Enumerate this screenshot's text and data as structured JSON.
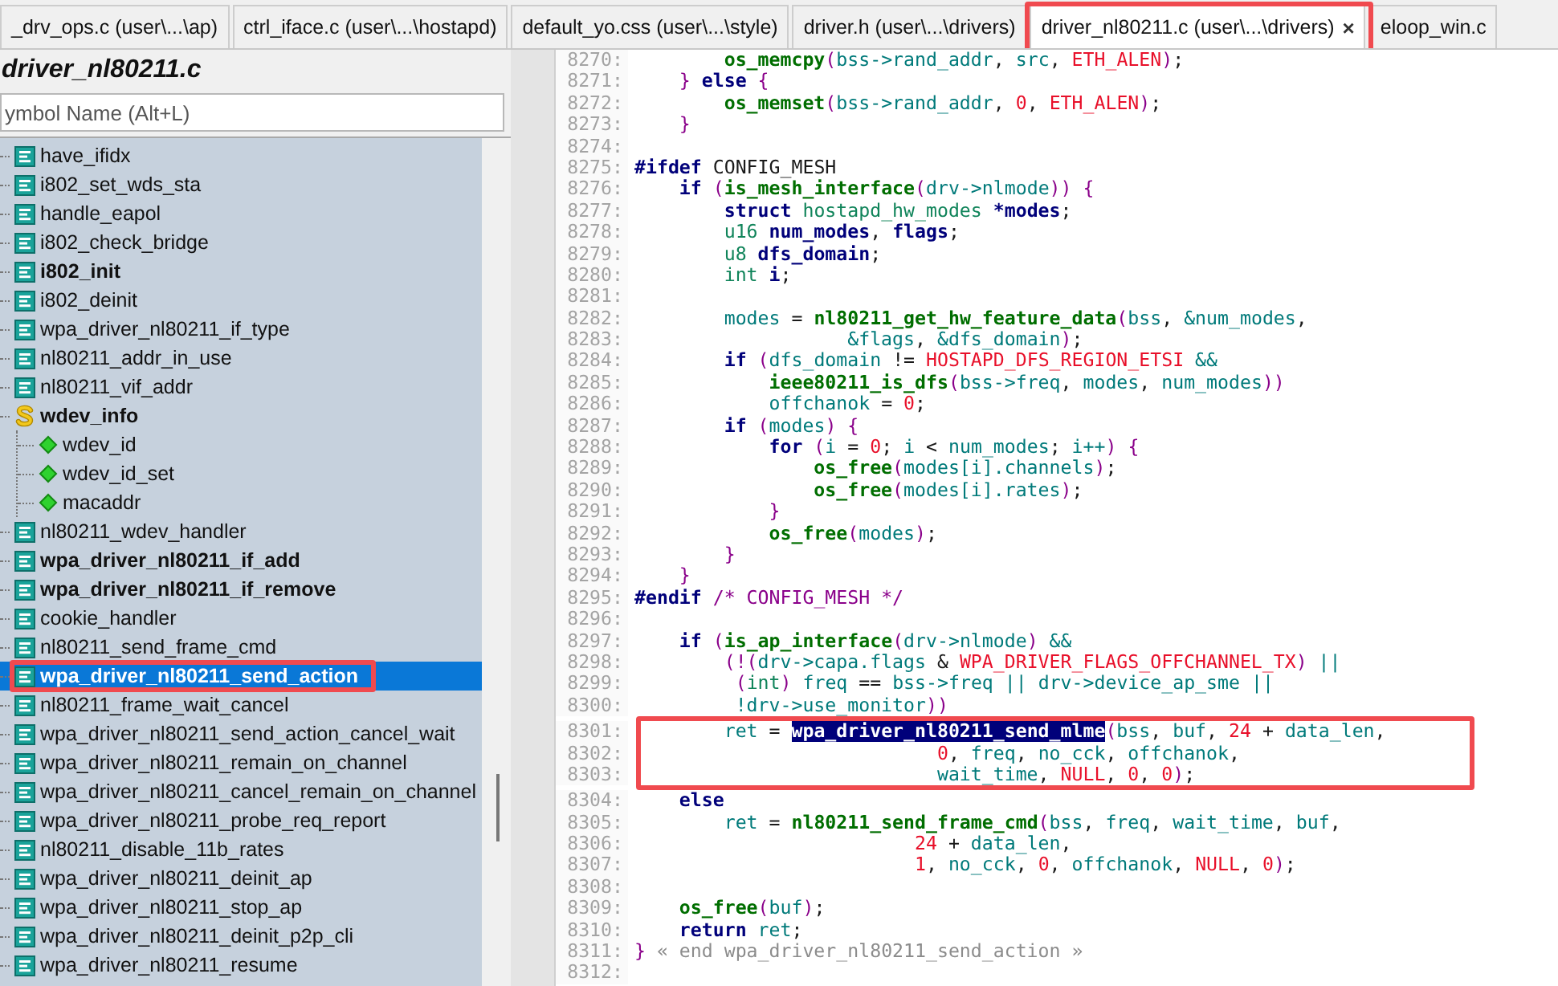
{
  "tabs": [
    {
      "label": "_drv_ops.c (user\\...\\ap)",
      "selected": false,
      "annotated": false
    },
    {
      "label": "ctrl_iface.c (user\\...\\hostapd)",
      "selected": false,
      "annotated": false
    },
    {
      "label": "default_yo.css (user\\...\\style)",
      "selected": false,
      "annotated": false
    },
    {
      "label": "driver.h (user\\...\\drivers)",
      "selected": false,
      "annotated": false
    },
    {
      "label": "driver_nl80211.c (user\\...\\drivers)",
      "selected": true,
      "annotated": true,
      "close": "×"
    },
    {
      "label": "eloop_win.c",
      "selected": false,
      "annotated": false
    }
  ],
  "symbol_panel": {
    "title": "driver_nl80211.c",
    "search": {
      "placeholder": "ymbol Name (Alt+L)"
    },
    "items": [
      {
        "label": "have_ifidx",
        "kind": "function",
        "bold": false,
        "selected": false,
        "annotated": false
      },
      {
        "label": "i802_set_wds_sta",
        "kind": "function",
        "bold": false,
        "selected": false,
        "annotated": false
      },
      {
        "label": "handle_eapol",
        "kind": "function",
        "bold": false,
        "selected": false,
        "annotated": false
      },
      {
        "label": "i802_check_bridge",
        "kind": "function",
        "bold": false,
        "selected": false,
        "annotated": false
      },
      {
        "label": "i802_init",
        "kind": "function",
        "bold": true,
        "selected": false,
        "annotated": false
      },
      {
        "label": "i802_deinit",
        "kind": "function",
        "bold": false,
        "selected": false,
        "annotated": false
      },
      {
        "label": "wpa_driver_nl80211_if_type",
        "kind": "function",
        "bold": false,
        "selected": false,
        "annotated": false
      },
      {
        "label": "nl80211_addr_in_use",
        "kind": "function",
        "bold": false,
        "selected": false,
        "annotated": false
      },
      {
        "label": "nl80211_vif_addr",
        "kind": "function",
        "bold": false,
        "selected": false,
        "annotated": false
      },
      {
        "label": "wdev_info",
        "kind": "struct",
        "bold": true,
        "selected": false,
        "annotated": false,
        "children": [
          {
            "label": "wdev_id",
            "kind": "member",
            "bold": false,
            "selected": false,
            "annotated": false
          },
          {
            "label": "wdev_id_set",
            "kind": "member",
            "bold": false,
            "selected": false,
            "annotated": false
          },
          {
            "label": "macaddr",
            "kind": "member",
            "bold": false,
            "selected": false,
            "annotated": false
          }
        ]
      },
      {
        "label": "nl80211_wdev_handler",
        "kind": "function",
        "bold": false,
        "selected": false,
        "annotated": false
      },
      {
        "label": "wpa_driver_nl80211_if_add",
        "kind": "function",
        "bold": true,
        "selected": false,
        "annotated": false
      },
      {
        "label": "wpa_driver_nl80211_if_remove",
        "kind": "function",
        "bold": true,
        "selected": false,
        "annotated": false
      },
      {
        "label": "cookie_handler",
        "kind": "function",
        "bold": false,
        "selected": false,
        "annotated": false
      },
      {
        "label": "nl80211_send_frame_cmd",
        "kind": "function",
        "bold": false,
        "selected": false,
        "annotated": false
      },
      {
        "label": "wpa_driver_nl80211_send_action",
        "kind": "function",
        "bold": true,
        "selected": true,
        "annotated": true
      },
      {
        "label": "nl80211_frame_wait_cancel",
        "kind": "function",
        "bold": false,
        "selected": false,
        "annotated": false
      },
      {
        "label": "wpa_driver_nl80211_send_action_cancel_wait",
        "kind": "function",
        "bold": false,
        "selected": false,
        "annotated": false
      },
      {
        "label": "wpa_driver_nl80211_remain_on_channel",
        "kind": "function",
        "bold": false,
        "selected": false,
        "annotated": false
      },
      {
        "label": "wpa_driver_nl80211_cancel_remain_on_channel",
        "kind": "function",
        "bold": false,
        "selected": false,
        "annotated": false
      },
      {
        "label": "wpa_driver_nl80211_probe_req_report",
        "kind": "function",
        "bold": false,
        "selected": false,
        "annotated": false
      },
      {
        "label": "nl80211_disable_11b_rates",
        "kind": "function",
        "bold": false,
        "selected": false,
        "annotated": false
      },
      {
        "label": "wpa_driver_nl80211_deinit_ap",
        "kind": "function",
        "bold": false,
        "selected": false,
        "annotated": false
      },
      {
        "label": "wpa_driver_nl80211_stop_ap",
        "kind": "function",
        "bold": false,
        "selected": false,
        "annotated": false
      },
      {
        "label": "wpa_driver_nl80211_deinit_p2p_cli",
        "kind": "function",
        "bold": false,
        "selected": false,
        "annotated": false
      },
      {
        "label": "wpa_driver_nl80211_resume",
        "kind": "function",
        "bold": false,
        "selected": false,
        "annotated": false
      }
    ]
  },
  "editor": {
    "lines": [
      {
        "number": "8270:",
        "annotated": false,
        "tokens": [
          {
            "kind": "fn",
            "text": "        os_memcpy"
          },
          {
            "kind": "punct",
            "text": "("
          },
          {
            "kind": "var",
            "text": "bss->rand_addr"
          },
          {
            "kind": "plain",
            "text": ", "
          },
          {
            "kind": "var",
            "text": "src"
          },
          {
            "kind": "plain",
            "text": ", "
          },
          {
            "kind": "const",
            "text": "ETH_ALEN"
          },
          {
            "kind": "punct",
            "text": ")"
          },
          {
            "kind": "plain",
            "text": ";"
          }
        ]
      },
      {
        "number": "8271:",
        "annotated": false,
        "tokens": [
          {
            "kind": "punct",
            "text": "    }"
          },
          {
            "kind": "keyword",
            "text": " else"
          },
          {
            "kind": "punct",
            "text": " {"
          }
        ]
      },
      {
        "number": "8272:",
        "annotated": false,
        "tokens": [
          {
            "kind": "fn",
            "text": "        os_memset"
          },
          {
            "kind": "punct",
            "text": "("
          },
          {
            "kind": "var",
            "text": "bss->rand_addr"
          },
          {
            "kind": "plain",
            "text": ", "
          },
          {
            "kind": "const",
            "text": "0"
          },
          {
            "kind": "plain",
            "text": ", "
          },
          {
            "kind": "const",
            "text": "ETH_ALEN"
          },
          {
            "kind": "punct",
            "text": ")"
          },
          {
            "kind": "plain",
            "text": ";"
          }
        ]
      },
      {
        "number": "8273:",
        "annotated": false,
        "tokens": [
          {
            "kind": "punct",
            "text": "    }"
          }
        ]
      },
      {
        "number": "8274:",
        "annotated": false
      },
      {
        "number": "8275:",
        "annotated": false,
        "tokens": [
          {
            "kind": "keyword",
            "text": "#ifdef"
          },
          {
            "kind": "plain",
            "text": " CONFIG_MESH"
          }
        ]
      },
      {
        "number": "8276:",
        "annotated": false,
        "tokens": [
          {
            "kind": "keyword",
            "text": "    if"
          },
          {
            "kind": "punct",
            "text": " ("
          },
          {
            "kind": "fn",
            "text": "is_mesh_interface"
          },
          {
            "kind": "punct",
            "text": "("
          },
          {
            "kind": "var",
            "text": "drv->nlmode"
          },
          {
            "kind": "punct",
            "text": ")) {"
          }
        ]
      },
      {
        "number": "8277:",
        "annotated": false,
        "tokens": [
          {
            "kind": "keyword",
            "text": "        struct"
          },
          {
            "kind": "type",
            "text": " hostapd_hw_modes"
          },
          {
            "kind": "decl",
            "text": " *modes"
          },
          {
            "kind": "plain",
            "text": ";"
          }
        ]
      },
      {
        "number": "8278:",
        "annotated": false,
        "tokens": [
          {
            "kind": "type",
            "text": "        u16"
          },
          {
            "kind": "decl",
            "text": " num_modes"
          },
          {
            "kind": "plain",
            "text": ", "
          },
          {
            "kind": "decl",
            "text": "flags"
          },
          {
            "kind": "plain",
            "text": ";"
          }
        ]
      },
      {
        "number": "8279:",
        "annotated": false,
        "tokens": [
          {
            "kind": "type",
            "text": "        u8"
          },
          {
            "kind": "decl",
            "text": " dfs_domain"
          },
          {
            "kind": "plain",
            "text": ";"
          }
        ]
      },
      {
        "number": "8280:",
        "annotated": false,
        "tokens": [
          {
            "kind": "type",
            "text": "        int"
          },
          {
            "kind": "decl",
            "text": " i"
          },
          {
            "kind": "plain",
            "text": ";"
          }
        ]
      },
      {
        "number": "8281:",
        "annotated": false
      },
      {
        "number": "8282:",
        "annotated": false,
        "tokens": [
          {
            "kind": "var",
            "text": "        modes"
          },
          {
            "kind": "plain",
            "text": " = "
          },
          {
            "kind": "fn",
            "text": "nl80211_get_hw_feature_data"
          },
          {
            "kind": "punct",
            "text": "("
          },
          {
            "kind": "var",
            "text": "bss"
          },
          {
            "kind": "plain",
            "text": ", "
          },
          {
            "kind": "var",
            "text": "&num_modes"
          },
          {
            "kind": "plain",
            "text": ","
          }
        ]
      },
      {
        "number": "8283:",
        "annotated": false,
        "tokens": [
          {
            "kind": "var",
            "text": "                   &flags"
          },
          {
            "kind": "plain",
            "text": ", "
          },
          {
            "kind": "var",
            "text": "&dfs_domain"
          },
          {
            "kind": "punct",
            "text": ")"
          },
          {
            "kind": "plain",
            "text": ";"
          }
        ]
      },
      {
        "number": "8284:",
        "annotated": false,
        "tokens": [
          {
            "kind": "keyword",
            "text": "        if"
          },
          {
            "kind": "punct",
            "text": " ("
          },
          {
            "kind": "var",
            "text": "dfs_domain"
          },
          {
            "kind": "plain",
            "text": " != "
          },
          {
            "kind": "const",
            "text": "HOSTAPD_DFS_REGION_ETSI"
          },
          {
            "kind": "var",
            "text": " &&"
          }
        ]
      },
      {
        "number": "8285:",
        "annotated": false,
        "tokens": [
          {
            "kind": "fn",
            "text": "            ieee80211_is_dfs"
          },
          {
            "kind": "punct",
            "text": "("
          },
          {
            "kind": "var",
            "text": "bss->freq"
          },
          {
            "kind": "plain",
            "text": ", "
          },
          {
            "kind": "var",
            "text": "modes"
          },
          {
            "kind": "plain",
            "text": ", "
          },
          {
            "kind": "var",
            "text": "num_modes"
          },
          {
            "kind": "punct",
            "text": "))"
          }
        ]
      },
      {
        "number": "8286:",
        "annotated": false,
        "tokens": [
          {
            "kind": "var",
            "text": "            offchanok"
          },
          {
            "kind": "plain",
            "text": " = "
          },
          {
            "kind": "const",
            "text": "0"
          },
          {
            "kind": "plain",
            "text": ";"
          }
        ]
      },
      {
        "number": "8287:",
        "annotated": false,
        "tokens": [
          {
            "kind": "keyword",
            "text": "        if"
          },
          {
            "kind": "punct",
            "text": " ("
          },
          {
            "kind": "var",
            "text": "modes"
          },
          {
            "kind": "punct",
            "text": ") {"
          }
        ]
      },
      {
        "number": "8288:",
        "annotated": false,
        "tokens": [
          {
            "kind": "keyword",
            "text": "            for"
          },
          {
            "kind": "punct",
            "text": " ("
          },
          {
            "kind": "var",
            "text": "i"
          },
          {
            "kind": "plain",
            "text": " = "
          },
          {
            "kind": "const",
            "text": "0"
          },
          {
            "kind": "plain",
            "text": "; "
          },
          {
            "kind": "var",
            "text": "i"
          },
          {
            "kind": "plain",
            "text": " < "
          },
          {
            "kind": "var",
            "text": "num_modes"
          },
          {
            "kind": "plain",
            "text": "; "
          },
          {
            "kind": "var",
            "text": "i++"
          },
          {
            "kind": "punct",
            "text": ") {"
          }
        ]
      },
      {
        "number": "8289:",
        "annotated": false,
        "tokens": [
          {
            "kind": "fn",
            "text": "                os_free"
          },
          {
            "kind": "punct",
            "text": "("
          },
          {
            "kind": "var",
            "text": "modes[i].channels"
          },
          {
            "kind": "punct",
            "text": ")"
          },
          {
            "kind": "plain",
            "text": ";"
          }
        ]
      },
      {
        "number": "8290:",
        "annotated": false,
        "tokens": [
          {
            "kind": "fn",
            "text": "                os_free"
          },
          {
            "kind": "punct",
            "text": "("
          },
          {
            "kind": "var",
            "text": "modes[i].rates"
          },
          {
            "kind": "punct",
            "text": ")"
          },
          {
            "kind": "plain",
            "text": ";"
          }
        ]
      },
      {
        "number": "8291:",
        "annotated": false,
        "tokens": [
          {
            "kind": "punct",
            "text": "            }"
          }
        ]
      },
      {
        "number": "8292:",
        "annotated": false,
        "tokens": [
          {
            "kind": "fn",
            "text": "            os_free"
          },
          {
            "kind": "punct",
            "text": "("
          },
          {
            "kind": "var",
            "text": "modes"
          },
          {
            "kind": "punct",
            "text": ")"
          },
          {
            "kind": "plain",
            "text": ";"
          }
        ]
      },
      {
        "number": "8293:",
        "annotated": false,
        "tokens": [
          {
            "kind": "punct",
            "text": "        }"
          }
        ]
      },
      {
        "number": "8294:",
        "annotated": false,
        "tokens": [
          {
            "kind": "punct",
            "text": "    }"
          }
        ]
      },
      {
        "number": "8295:",
        "annotated": false,
        "tokens": [
          {
            "kind": "keyword",
            "text": "#endif"
          },
          {
            "kind": "comment",
            "text": " /* CONFIG_MESH */"
          }
        ]
      },
      {
        "number": "8296:",
        "annotated": false
      },
      {
        "number": "8297:",
        "annotated": false,
        "tokens": [
          {
            "kind": "keyword",
            "text": "    if"
          },
          {
            "kind": "punct",
            "text": " ("
          },
          {
            "kind": "fn",
            "text": "is_ap_interface"
          },
          {
            "kind": "punct",
            "text": "("
          },
          {
            "kind": "var",
            "text": "drv->nlmode"
          },
          {
            "kind": "punct",
            "text": ")"
          },
          {
            "kind": "var",
            "text": " &&"
          }
        ]
      },
      {
        "number": "8298:",
        "annotated": false,
        "tokens": [
          {
            "kind": "punct",
            "text": "        (!("
          },
          {
            "kind": "var",
            "text": "drv->capa.flags"
          },
          {
            "kind": "plain",
            "text": " & "
          },
          {
            "kind": "const",
            "text": "WPA_DRIVER_FLAGS_OFFCHANNEL_TX"
          },
          {
            "kind": "punct",
            "text": ")"
          },
          {
            "kind": "var",
            "text": " ||"
          }
        ]
      },
      {
        "number": "8299:",
        "annotated": false,
        "tokens": [
          {
            "kind": "punct",
            "text": "         ("
          },
          {
            "kind": "type",
            "text": "int"
          },
          {
            "kind": "punct",
            "text": ")"
          },
          {
            "kind": "var",
            "text": " freq"
          },
          {
            "kind": "plain",
            "text": " == "
          },
          {
            "kind": "var",
            "text": "bss->freq"
          },
          {
            "kind": "var",
            "text": " ||"
          },
          {
            "kind": "var",
            "text": " drv->device_ap_sme"
          },
          {
            "kind": "var",
            "text": " ||"
          }
        ]
      },
      {
        "number": "8300:",
        "annotated": false,
        "tokens": [
          {
            "kind": "var",
            "text": "         !drv->use_monitor"
          },
          {
            "kind": "punct",
            "text": "))"
          }
        ]
      },
      {
        "number": "8301:",
        "annotated": true,
        "tokens": [
          {
            "kind": "var",
            "text": "        ret"
          },
          {
            "kind": "plain",
            "text": " = "
          },
          {
            "kind": "selected",
            "text": "wpa_driver_nl80211_send_mlme"
          },
          {
            "kind": "punct",
            "text": "("
          },
          {
            "kind": "var",
            "text": "bss"
          },
          {
            "kind": "plain",
            "text": ", "
          },
          {
            "kind": "var",
            "text": "buf"
          },
          {
            "kind": "plain",
            "text": ", "
          },
          {
            "kind": "const",
            "text": "24"
          },
          {
            "kind": "plain",
            "text": " + "
          },
          {
            "kind": "var",
            "text": "data_len"
          },
          {
            "kind": "plain",
            "text": ","
          }
        ]
      },
      {
        "number": "8302:",
        "annotated": true,
        "tokens": [
          {
            "kind": "const",
            "text": "                           0"
          },
          {
            "kind": "plain",
            "text": ", "
          },
          {
            "kind": "var",
            "text": "freq"
          },
          {
            "kind": "plain",
            "text": ", "
          },
          {
            "kind": "var",
            "text": "no_cck"
          },
          {
            "kind": "plain",
            "text": ", "
          },
          {
            "kind": "var",
            "text": "offchanok"
          },
          {
            "kind": "plain",
            "text": ","
          }
        ]
      },
      {
        "number": "8303:",
        "annotated": true,
        "tokens": [
          {
            "kind": "var",
            "text": "                           wait_time"
          },
          {
            "kind": "plain",
            "text": ", "
          },
          {
            "kind": "const",
            "text": "NULL"
          },
          {
            "kind": "plain",
            "text": ", "
          },
          {
            "kind": "const",
            "text": "0"
          },
          {
            "kind": "plain",
            "text": ", "
          },
          {
            "kind": "const",
            "text": "0"
          },
          {
            "kind": "punct",
            "text": ")"
          },
          {
            "kind": "plain",
            "text": ";"
          }
        ]
      },
      {
        "number": "8304:",
        "annotated": false,
        "tokens": [
          {
            "kind": "keyword",
            "text": "    else"
          }
        ]
      },
      {
        "number": "8305:",
        "annotated": false,
        "tokens": [
          {
            "kind": "var",
            "text": "        ret"
          },
          {
            "kind": "plain",
            "text": " = "
          },
          {
            "kind": "fn",
            "text": "nl80211_send_frame_cmd"
          },
          {
            "kind": "punct",
            "text": "("
          },
          {
            "kind": "var",
            "text": "bss"
          },
          {
            "kind": "plain",
            "text": ", "
          },
          {
            "kind": "var",
            "text": "freq"
          },
          {
            "kind": "plain",
            "text": ", "
          },
          {
            "kind": "var",
            "text": "wait_time"
          },
          {
            "kind": "plain",
            "text": ", "
          },
          {
            "kind": "var",
            "text": "buf"
          },
          {
            "kind": "plain",
            "text": ","
          }
        ]
      },
      {
        "number": "8306:",
        "annotated": false,
        "tokens": [
          {
            "kind": "const",
            "text": "                         24"
          },
          {
            "kind": "plain",
            "text": " + "
          },
          {
            "kind": "var",
            "text": "data_len"
          },
          {
            "kind": "plain",
            "text": ","
          }
        ]
      },
      {
        "number": "8307:",
        "annotated": false,
        "tokens": [
          {
            "kind": "const",
            "text": "                         1"
          },
          {
            "kind": "plain",
            "text": ", "
          },
          {
            "kind": "var",
            "text": "no_cck"
          },
          {
            "kind": "plain",
            "text": ", "
          },
          {
            "kind": "const",
            "text": "0"
          },
          {
            "kind": "plain",
            "text": ", "
          },
          {
            "kind": "var",
            "text": "offchanok"
          },
          {
            "kind": "plain",
            "text": ", "
          },
          {
            "kind": "const",
            "text": "NULL"
          },
          {
            "kind": "plain",
            "text": ", "
          },
          {
            "kind": "const",
            "text": "0"
          },
          {
            "kind": "punct",
            "text": ")"
          },
          {
            "kind": "plain",
            "text": ";"
          }
        ]
      },
      {
        "number": "8308:",
        "annotated": false
      },
      {
        "number": "8309:",
        "annotated": false,
        "tokens": [
          {
            "kind": "fn",
            "text": "    os_free"
          },
          {
            "kind": "punct",
            "text": "("
          },
          {
            "kind": "var",
            "text": "buf"
          },
          {
            "kind": "punct",
            "text": ")"
          },
          {
            "kind": "plain",
            "text": ";"
          }
        ]
      },
      {
        "number": "8310:",
        "annotated": false,
        "tokens": [
          {
            "kind": "keyword",
            "text": "    return"
          },
          {
            "kind": "var",
            "text": " ret"
          },
          {
            "kind": "plain",
            "text": ";"
          }
        ]
      },
      {
        "number": "8311:",
        "annotated": false,
        "tokens": [
          {
            "kind": "punct",
            "text": "}"
          },
          {
            "kind": "endnote",
            "text": " « end wpa_driver_nl80211_send_action »"
          }
        ]
      },
      {
        "number": "8312:",
        "annotated": false
      }
    ]
  }
}
